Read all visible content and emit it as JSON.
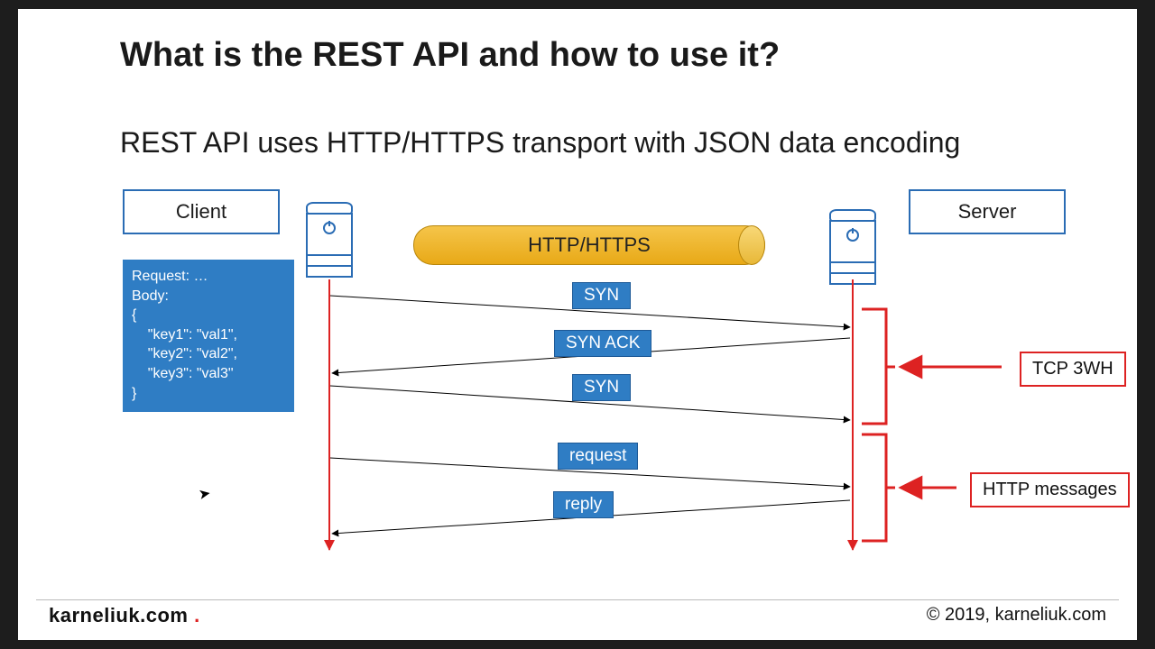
{
  "title": "What is the REST API and how to use it?",
  "subtitle": "REST API uses HTTP/HTTPS transport with JSON data encoding",
  "roles": {
    "client": "Client",
    "server": "Server"
  },
  "pipe_label": "HTTP/HTTPS",
  "code_box": "Request: …\nBody:\n{\n    \"key1\": \"val1\",\n    \"key2\": \"val2\",\n    \"key3\": \"val3\"\n}",
  "messages": {
    "syn1": "SYN",
    "synack": "SYN ACK",
    "syn2": "SYN",
    "request": "request",
    "reply": "reply"
  },
  "annotations": {
    "tcp3wh": "TCP 3WH",
    "http_messages": "HTTP messages"
  },
  "footer": {
    "brand": "karneliuk.com",
    "copyright": "© 2019, karneliuk.com"
  }
}
